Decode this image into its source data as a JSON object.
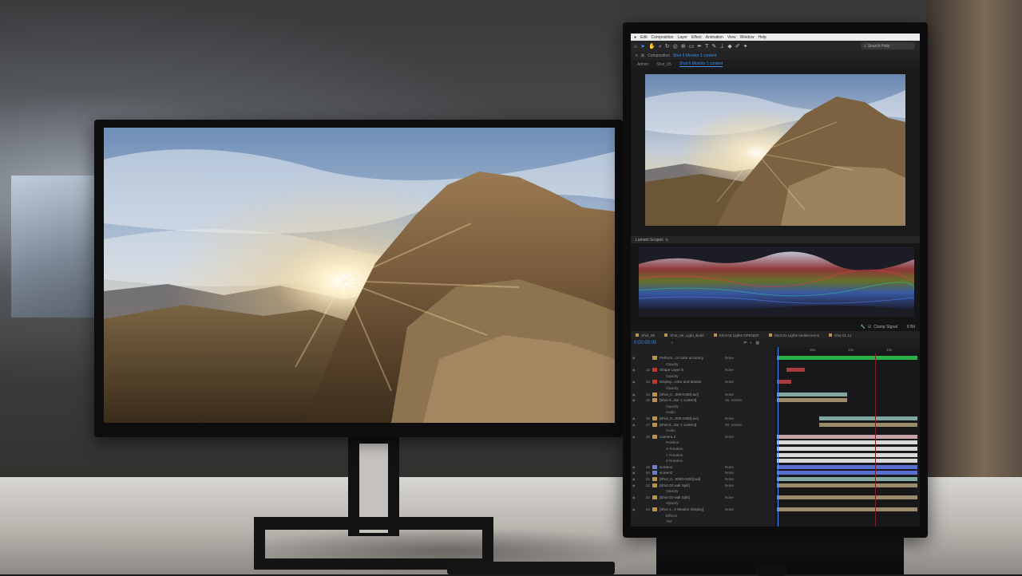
{
  "scene": {
    "description_colors": {
      "accent": "#3d8ff5",
      "label_gold": "#b7934f",
      "green_bar": "#2bb24a"
    }
  },
  "right_monitor": {
    "menubar": [
      "",
      "Edit",
      "Composition",
      "Layer",
      "Effect",
      "Animation",
      "View",
      "Window",
      "Help"
    ],
    "search_label": "Search Help",
    "comp_header": {
      "prefix": "Composition",
      "comp_name": "Shot 6 Monitor 1 content"
    },
    "comp_tabs": [
      {
        "label": "Admin",
        "active": false
      },
      {
        "label": "Shot_05",
        "active": false
      },
      {
        "label": "Shot 6 Monitor 1 content",
        "active": true
      }
    ],
    "scopes_title": "Lumetri Scopes",
    "clamp_label": "Clamp Signal",
    "bits_label": "8 Bit",
    "timeline_tabs": [
      "Shot_05",
      "Shot_05_Light_Build",
      "Shot 03 Lights OPENER",
      "Shot 01 Lights Multiscreens",
      "shot 01 1J"
    ],
    "timecode": "0:00:00:00",
    "ruler_marks": [
      "05s",
      "10s",
      "15s"
    ],
    "layers": [
      {
        "num": "",
        "name": "Perform...or color accuracy",
        "mode": "None",
        "color": "#b7934f",
        "sub": false
      },
      {
        "num": "",
        "name": "Opacity",
        "mode": "",
        "color": "",
        "sub": true
      },
      {
        "num": "12",
        "name": "Shape Layer 6",
        "mode": "None",
        "color": "#c0392b",
        "sub": false
      },
      {
        "num": "",
        "name": "Opacity",
        "mode": "",
        "color": "",
        "sub": true
      },
      {
        "num": "13",
        "name": "Display...color and details",
        "mode": "None",
        "color": "#c0392b",
        "sub": false
      },
      {
        "num": "",
        "name": "Opacity",
        "mode": "",
        "color": "",
        "sub": true
      },
      {
        "num": "14",
        "name": "[Shot_0...000-0450].avi]",
        "mode": "None",
        "color": "#b7934f",
        "sub": false
      },
      {
        "num": "15",
        "name": "[Shot 6...itor 1 content]",
        "mode": "15. screen",
        "color": "#b7934f",
        "sub": false
      },
      {
        "num": "",
        "name": "Opacity",
        "mode": "",
        "color": "",
        "sub": true
      },
      {
        "num": "",
        "name": "Audio",
        "mode": "",
        "color": "",
        "sub": true
      },
      {
        "num": "16",
        "name": "[Shot_0...000-0450].avi]",
        "mode": "None",
        "color": "#b7934f",
        "sub": false
      },
      {
        "num": "17",
        "name": "[Shot 6...itor 1 content]",
        "mode": "20. screen",
        "color": "#b7934f",
        "sub": false
      },
      {
        "num": "",
        "name": "Audio",
        "mode": "",
        "color": "",
        "sub": true
      },
      {
        "num": "18",
        "name": "Camera 2",
        "mode": "None",
        "color": "#b7934f",
        "sub": false
      },
      {
        "num": "",
        "name": "Position",
        "mode": "",
        "color": "",
        "sub": true
      },
      {
        "num": "",
        "name": "X Rotation",
        "mode": "",
        "color": "",
        "sub": true
      },
      {
        "num": "",
        "name": "Y Rotation",
        "mode": "",
        "color": "",
        "sub": true
      },
      {
        "num": "",
        "name": "Z Rotation",
        "mode": "",
        "color": "",
        "sub": true
      },
      {
        "num": "19",
        "name": "screen1",
        "mode": "None",
        "color": "#6c7ec9",
        "sub": false
      },
      {
        "num": "20",
        "name": "screen2",
        "mode": "None",
        "color": "#6c7ec9",
        "sub": false
      },
      {
        "num": "21",
        "name": "[Shot_0...0000-0450].avi]",
        "mode": "None",
        "color": "#b7934f",
        "sub": false
      },
      {
        "num": "22",
        "name": "[Shot 03 wall Split]",
        "mode": "None",
        "color": "#b7934f",
        "sub": false
      },
      {
        "num": "",
        "name": "Opacity",
        "mode": "",
        "color": "",
        "sub": true
      },
      {
        "num": "23",
        "name": "[Shot 03 wall Split]",
        "mode": "None",
        "color": "#b7934f",
        "sub": false
      },
      {
        "num": "",
        "name": "Opacity",
        "mode": "",
        "color": "",
        "sub": true
      },
      {
        "num": "24",
        "name": "[Shot 1...2 Monitor Display]",
        "mode": "None",
        "color": "#b7934f",
        "sub": false
      },
      {
        "num": "",
        "name": "Effects",
        "mode": "",
        "color": "",
        "sub": true
      },
      {
        "num": "",
        "name": "Tint",
        "mode": "",
        "color": "",
        "sub": true
      }
    ],
    "track_bars": [
      {
        "row": 0,
        "start": 0.0,
        "end": 1.0,
        "color": "#2bb24a"
      },
      {
        "row": 2,
        "start": 0.07,
        "end": 0.2,
        "color": "#a83c3c"
      },
      {
        "row": 4,
        "start": 0.0,
        "end": 0.1,
        "color": "#a83c3c"
      },
      {
        "row": 6,
        "start": 0.0,
        "end": 0.5,
        "color": "#7fa7a0"
      },
      {
        "row": 7,
        "start": 0.0,
        "end": 0.5,
        "color": "#9a8c6a"
      },
      {
        "row": 10,
        "start": 0.3,
        "end": 1.0,
        "color": "#7fa7a0"
      },
      {
        "row": 11,
        "start": 0.3,
        "end": 1.0,
        "color": "#9a8c6a"
      },
      {
        "row": 13,
        "start": 0.0,
        "end": 1.0,
        "color": "#c8a5a8"
      },
      {
        "row": 14,
        "start": 0.0,
        "end": 1.0,
        "color": "#d8d8d8"
      },
      {
        "row": 15,
        "start": 0.0,
        "end": 1.0,
        "color": "#d8d8d8"
      },
      {
        "row": 16,
        "start": 0.0,
        "end": 1.0,
        "color": "#d8d8d8"
      },
      {
        "row": 17,
        "start": 0.0,
        "end": 1.0,
        "color": "#d8d8d8"
      },
      {
        "row": 18,
        "start": 0.0,
        "end": 1.0,
        "color": "#5a6fd0"
      },
      {
        "row": 19,
        "start": 0.0,
        "end": 1.0,
        "color": "#5a6fd0"
      },
      {
        "row": 20,
        "start": 0.0,
        "end": 1.0,
        "color": "#7fa7a0"
      },
      {
        "row": 21,
        "start": 0.0,
        "end": 1.0,
        "color": "#9a8c6a"
      },
      {
        "row": 23,
        "start": 0.0,
        "end": 1.0,
        "color": "#9a8c6a"
      },
      {
        "row": 25,
        "start": 0.0,
        "end": 1.0,
        "color": "#9a8c6a"
      }
    ]
  }
}
